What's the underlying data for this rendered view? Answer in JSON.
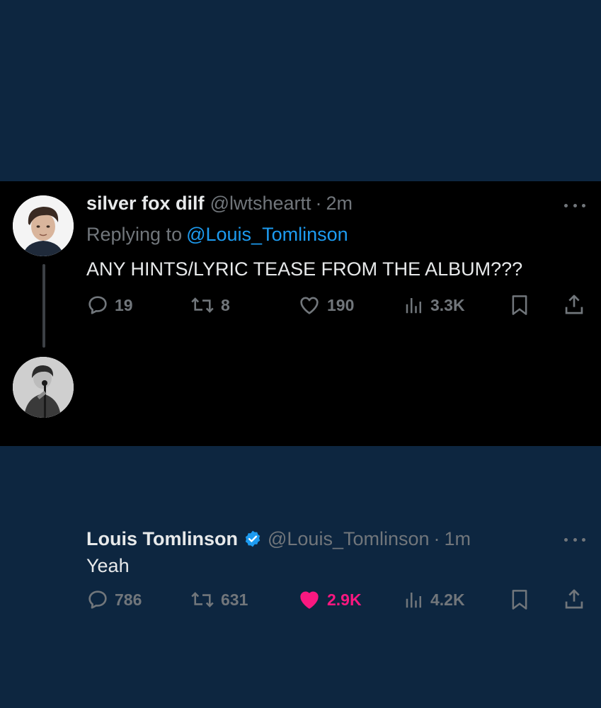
{
  "tweets": [
    {
      "name": "silver fox dilf",
      "handle": "@lwtsheartt",
      "separator": "·",
      "time": "2m",
      "replying_label": "Replying to",
      "replying_to": "@Louis_Tomlinson",
      "text": "ANY HINTS/LYRIC TEASE FROM THE ALBUM???",
      "replies": "19",
      "reposts": "8",
      "likes": "190",
      "views": "3.3K",
      "liked": false
    },
    {
      "name": "Louis Tomlinson",
      "handle": "@Louis_Tomlinson",
      "separator": "·",
      "time": "1m",
      "verified": true,
      "text": "Yeah",
      "replies": "786",
      "reposts": "631",
      "likes": "2.9K",
      "views": "4.2K",
      "liked": true
    }
  ],
  "icons": [
    "reply-icon",
    "repost-icon",
    "like-icon",
    "views-icon",
    "bookmark-icon",
    "share-icon",
    "more-icon",
    "verified-badge-icon"
  ],
  "colors": {
    "page_background": "#0d2640",
    "panel_background": "#000000",
    "primary_text": "#e7e9ea",
    "secondary_text": "#71767b",
    "link": "#1d9bf0",
    "like_active": "#f91880",
    "verified": "#1d9bf0"
  }
}
